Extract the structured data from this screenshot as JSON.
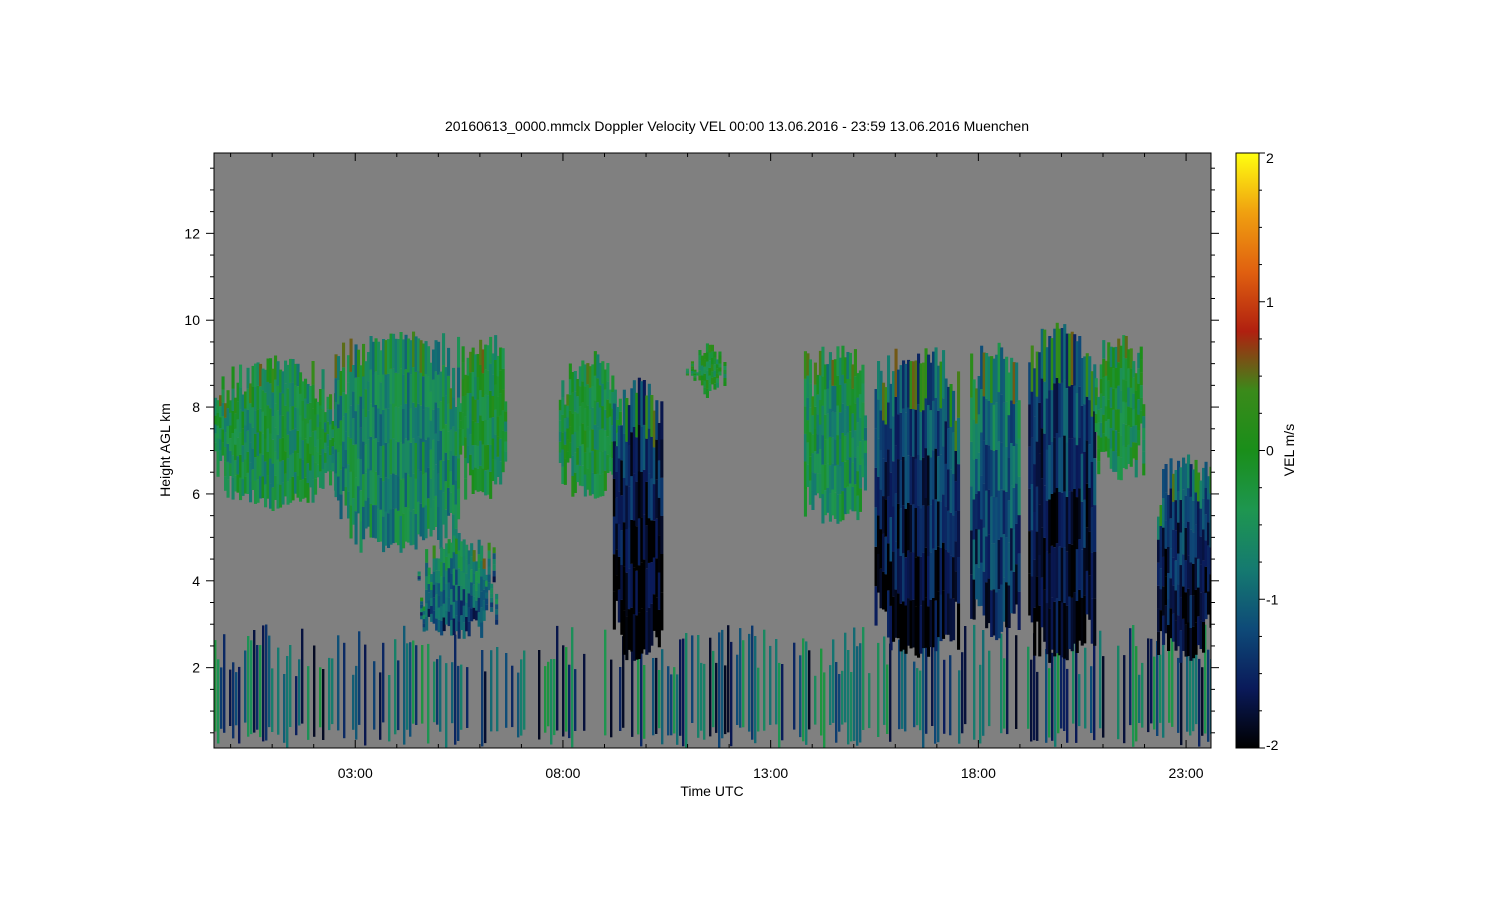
{
  "chart_data": {
    "type": "heatmap",
    "title": "20160613_0000.mmclx Doppler Velocity VEL   00:00 13.06.2016 - 23:59 13.06.2016 Muenchen",
    "xlabel": "Time UTC",
    "ylabel": "Height AGL km",
    "x_tick_labels": [
      "03:00",
      "08:00",
      "13:00",
      "18:00",
      "23:00"
    ],
    "x_tick_hours": [
      3,
      8,
      13,
      18,
      23
    ],
    "xlim_hours": [
      -0.4,
      23.6
    ],
    "y_tick_labels": [
      "2",
      "4",
      "6",
      "8",
      "10",
      "12"
    ],
    "y_tick_values": [
      2,
      4,
      6,
      8,
      10,
      12
    ],
    "ylim_km": [
      0.15,
      13.85
    ],
    "background_color": "#808080",
    "colorbar": {
      "label": "VEL m/s",
      "tick_labels": [
        "2",
        "1",
        "0",
        "-1",
        "-2"
      ],
      "tick_values": [
        2,
        1,
        0,
        -1,
        -2
      ],
      "range": [
        -2,
        2
      ],
      "colors": [
        "#000000",
        "#0a1a5a",
        "#0e4a78",
        "#157a70",
        "#1e9650",
        "#1a8e1a",
        "#3a8a1a",
        "#b02010",
        "#e06010",
        "#f0a010",
        "#ffff10"
      ]
    },
    "echo_regions": [
      {
        "t0": -0.4,
        "t1": 2.5,
        "base_km": 5.6,
        "top_km": 9.2,
        "mean_vel": -0.4
      },
      {
        "t0": 2.5,
        "t1": 5.5,
        "base_km": 4.6,
        "top_km": 9.8,
        "mean_vel": -0.6
      },
      {
        "t0": 5.5,
        "t1": 6.6,
        "base_km": 5.8,
        "top_km": 9.7,
        "mean_vel": -0.3
      },
      {
        "t0": 4.5,
        "t1": 6.4,
        "base_km": 2.6,
        "top_km": 5.2,
        "mean_vel": -0.4
      },
      {
        "t0": 7.9,
        "t1": 9.4,
        "base_km": 5.8,
        "top_km": 9.3,
        "mean_vel": -0.3
      },
      {
        "t0": 9.2,
        "t1": 10.4,
        "base_km": 2.1,
        "top_km": 8.7,
        "mean_vel": -1.2
      },
      {
        "t0": 10.9,
        "t1": 12.0,
        "base_km": 8.2,
        "top_km": 9.5,
        "mean_vel": -0.2
      },
      {
        "t0": 13.8,
        "t1": 15.3,
        "base_km": 5.2,
        "top_km": 9.5,
        "mean_vel": -0.5
      },
      {
        "t0": 15.5,
        "t1": 17.5,
        "base_km": 2.2,
        "top_km": 9.4,
        "mean_vel": -1.0
      },
      {
        "t0": 17.8,
        "t1": 19.0,
        "base_km": 2.6,
        "top_km": 9.5,
        "mean_vel": -0.6
      },
      {
        "t0": 19.2,
        "t1": 20.8,
        "base_km": 2.1,
        "top_km": 10.0,
        "mean_vel": -1.0
      },
      {
        "t0": 20.8,
        "t1": 22.0,
        "base_km": 6.3,
        "top_km": 9.7,
        "mean_vel": -0.3
      },
      {
        "t0": 22.3,
        "t1": 23.6,
        "base_km": 2.1,
        "top_km": 7.0,
        "mean_vel": -1.0
      }
    ],
    "boundary_layer": {
      "t0": -0.4,
      "t1": 23.6,
      "base_km": 0.15,
      "top_km": 3.0,
      "mean_vel": -0.9
    }
  }
}
